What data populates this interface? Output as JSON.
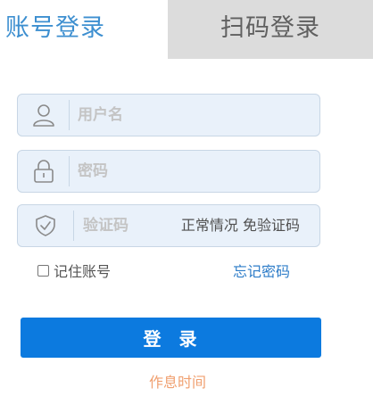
{
  "tabs": {
    "account_login": "账号登录",
    "qr_login": "扫码登录"
  },
  "form": {
    "username_placeholder": "用户名",
    "username_value": "",
    "password_placeholder": "密码",
    "password_value": "",
    "captcha_placeholder": "验证码",
    "captcha_value": "",
    "captcha_note": "正常情况 免验证码",
    "remember_label": "记住账号",
    "remember_checked": false,
    "forgot_label": "忘记密码",
    "submit_label": "登  录",
    "rest_time_label": "作息时间"
  },
  "icons": {
    "username": "user-icon",
    "password": "lock-icon",
    "captcha": "shield-check-icon"
  },
  "colors": {
    "accent_blue": "#0c7adf",
    "tab_active_text": "#3d8fd0",
    "tab_inactive_bg": "#dcdcdc",
    "field_bg": "#e9f1fa",
    "rest_link": "#f0a070"
  }
}
